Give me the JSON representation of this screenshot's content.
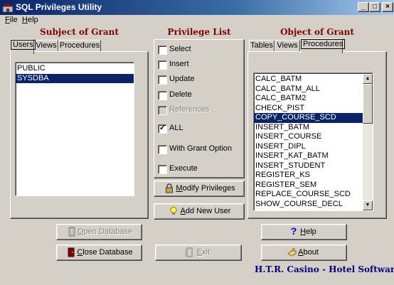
{
  "window": {
    "title": "SQL Privileges Utility"
  },
  "menu": {
    "items": [
      {
        "label": "File",
        "mnemonic": "F"
      },
      {
        "label": "Help",
        "mnemonic": "H"
      }
    ]
  },
  "subject": {
    "heading": "Subject of Grant",
    "tabs": [
      {
        "label": "Users",
        "active": true
      },
      {
        "label": "Views"
      },
      {
        "label": "Procedures"
      }
    ],
    "items": [
      {
        "label": "PUBLIC"
      },
      {
        "label": "SYSDBA",
        "selected": true
      }
    ]
  },
  "privileges": {
    "heading": "Privilege List",
    "items": [
      {
        "label": "Select",
        "checked": false,
        "disabled": false
      },
      {
        "label": "Insert",
        "checked": false,
        "disabled": false
      },
      {
        "label": "Update",
        "checked": false,
        "disabled": false
      },
      {
        "label": "Delete",
        "checked": false,
        "disabled": false
      },
      {
        "label": "References",
        "checked": false,
        "disabled": true
      },
      {
        "label": "ALL",
        "checked": true,
        "disabled": false
      },
      {
        "label": "With Grant Option",
        "checked": false,
        "disabled": false
      },
      {
        "label": "Execute",
        "checked": false,
        "disabled": false
      }
    ],
    "modify_button": {
      "label": "Modify Privileges",
      "mnemonic": "M"
    },
    "add_user_button": {
      "label": "Add New User",
      "mnemonic": "A"
    }
  },
  "object": {
    "heading": "Object of Grant",
    "tabs": [
      {
        "label": "Tables"
      },
      {
        "label": "Views"
      },
      {
        "label": "Procedures",
        "active": true
      }
    ],
    "items": [
      {
        "label": "CALC_BATM"
      },
      {
        "label": "CALC_BATM_ALL"
      },
      {
        "label": "CALC_BATM2"
      },
      {
        "label": "CHECK_PIST"
      },
      {
        "label": "COPY_COURSE_SCD",
        "selected": true
      },
      {
        "label": "INSERT_BATM"
      },
      {
        "label": "INSERT_COURSE"
      },
      {
        "label": "INSERT_DIPL"
      },
      {
        "label": "INSERT_KAT_BATM"
      },
      {
        "label": "INSERT_STUDENT"
      },
      {
        "label": "REGISTER_KS"
      },
      {
        "label": "REGISTER_SEM"
      },
      {
        "label": "REPLACE_COURSE_SCD"
      },
      {
        "label": "SHOW_COURSE_DECL"
      }
    ]
  },
  "buttons": {
    "open_database": {
      "label": "Open Database",
      "mnemonic": "O",
      "disabled": true
    },
    "close_database": {
      "label": "Close Database",
      "mnemonic": "C",
      "disabled": false
    },
    "exit": {
      "label": "Exit",
      "mnemonic": "E",
      "disabled": true
    },
    "help": {
      "label": "Help",
      "mnemonic": "H"
    },
    "about": {
      "label": "About",
      "mnemonic": "A"
    }
  },
  "footer": {
    "brand": "H.T.R. Casino - Hotel Software"
  },
  "colors": {
    "heading": "#800000",
    "brand": "#000080",
    "selection": "#0a246a"
  }
}
